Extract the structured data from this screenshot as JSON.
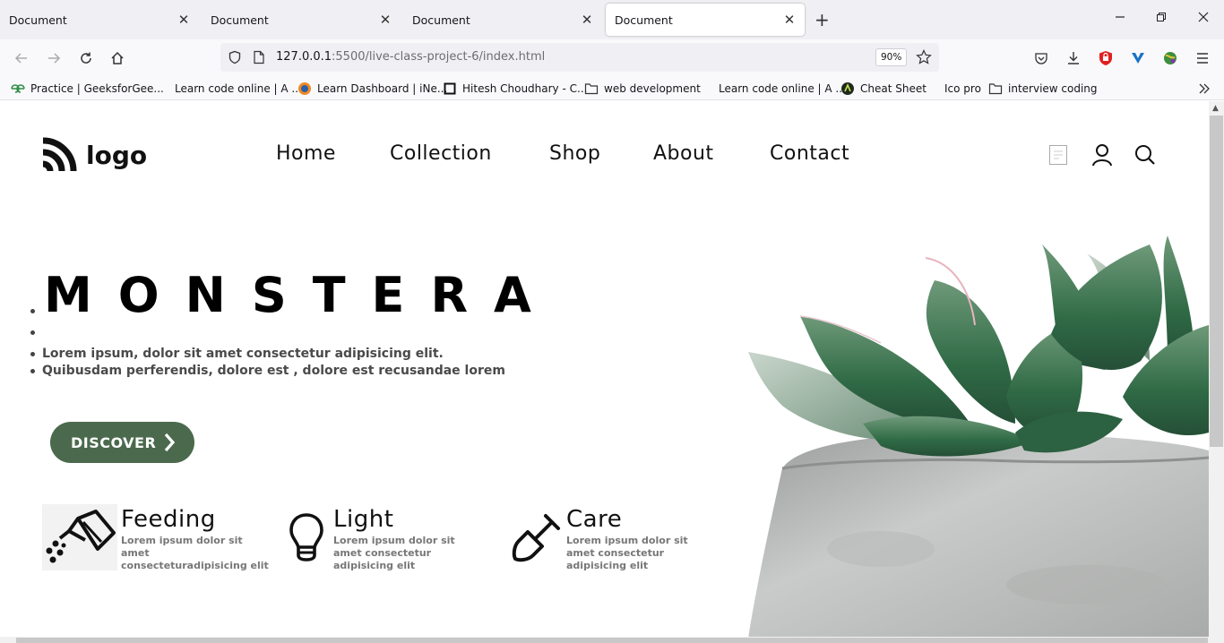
{
  "browser": {
    "tabs": [
      {
        "title": "Document",
        "active": false
      },
      {
        "title": "Document",
        "active": false
      },
      {
        "title": "Document",
        "active": false
      },
      {
        "title": "Document",
        "active": true
      }
    ],
    "url_host": "127.0.0.1",
    "url_rest": ":5500/live-class-project-6/index.html",
    "zoom": "90%",
    "bookmarks": [
      {
        "label": "Practice | GeeksforGee...",
        "icon": "gfg-icon"
      },
      {
        "label": "Learn code online | A ...",
        "icon": "page-icon"
      },
      {
        "label": "Learn Dashboard | iNe...",
        "icon": "ineuron-icon"
      },
      {
        "label": "Hitesh Choudhary - C...",
        "icon": "square-icon"
      },
      {
        "label": "web development",
        "icon": "folder-icon"
      },
      {
        "label": "Learn code online | A ...",
        "icon": "page-icon"
      },
      {
        "label": "Cheat Sheet",
        "icon": "cheatsheet-icon"
      },
      {
        "label": "Ico pro",
        "icon": "page-icon"
      },
      {
        "label": "interview coding",
        "icon": "folder-icon"
      }
    ]
  },
  "site": {
    "logo_text": "logo",
    "nav": [
      "Home",
      "Collection",
      "Shop",
      "About",
      "Contact"
    ],
    "hero_title": "MONSTERA",
    "bullets": [
      "",
      "",
      "Lorem ipsum, dolor sit amet consectetur adipisicing elit.",
      "Quibusdam perferendis, dolore est , dolore est recusandae lorem"
    ],
    "cta_label": "DISCOVER",
    "features": [
      {
        "title": "Feeding",
        "desc": "Lorem ipsum dolor sit amet consecteturadipisicing elit",
        "icon": "watering-can-icon"
      },
      {
        "title": "Light",
        "desc": "Lorem ipsum dolor sit amet consectetur adipisicing elit",
        "icon": "lightbulb-icon"
      },
      {
        "title": "Care",
        "desc": "Lorem ipsum dolor sit amet consectetur adipisicing elit",
        "icon": "shovel-icon"
      }
    ],
    "accent_color": "#4b6a4d"
  }
}
